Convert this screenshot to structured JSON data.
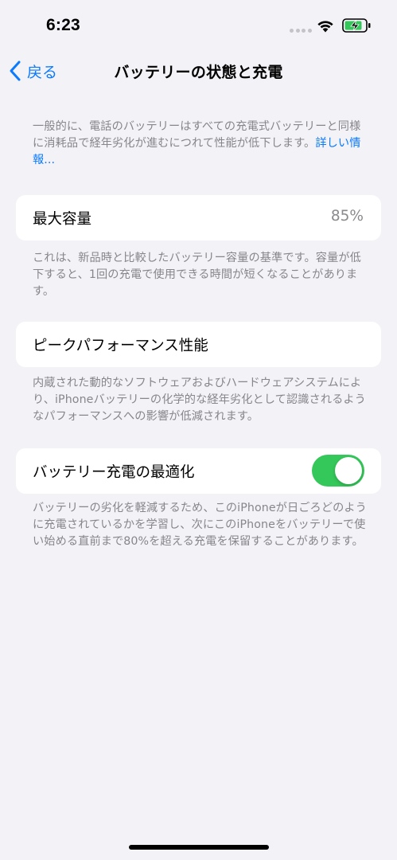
{
  "status_bar": {
    "time": "6:23"
  },
  "nav": {
    "back_label": "戻る",
    "title": "バッテリーの状態と充電"
  },
  "intro": {
    "text": "一般的に、電話のバッテリーはすべての充電式バッテリーと同様に消耗品で経年劣化が進むにつれて性能が低下します。",
    "link": "詳しい情報..."
  },
  "max_capacity": {
    "label": "最大容量",
    "value": "85%",
    "description": "これは、新品時と比較したバッテリー容量の基準です。容量が低下すると、1回の充電で使用できる時間が短くなることがあります。"
  },
  "peak_performance": {
    "label": "ピークパフォーマンス性能",
    "description": "内蔵された動的なソフトウェアおよびハードウェアシステムにより、iPhoneバッテリーの化学的な経年劣化として認識されるようなパフォーマンスへの影響が低減されます。"
  },
  "optimized_charging": {
    "label": "バッテリー充電の最適化",
    "enabled": true,
    "description": "バッテリーの劣化を軽減するため、このiPhoneが日ごろどのように充電されているかを学習し、次にこのiPhoneをバッテリーで使い始める直前まで80%を超える充電を保留することがあります。"
  },
  "colors": {
    "accent": "#0a7aff",
    "toggle_on": "#34c759",
    "background": "#f2f2f7"
  }
}
